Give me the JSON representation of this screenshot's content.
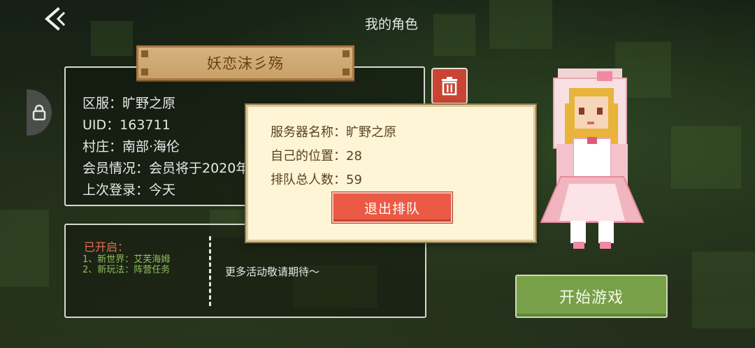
{
  "header": {
    "title": "我的角色",
    "back_icon": "chevron-left-icon"
  },
  "character": {
    "name": "妖恋沫彡殇",
    "info": [
      "区服：旷野之原",
      "UID：163711",
      "村庄：南部·海伦",
      "会员情况：会员将于2020年",
      "上次登录：今天"
    ]
  },
  "activities": {
    "title": "已开启：",
    "items": [
      "1、新世界：艾芙海姆",
      "2、新玩法：阵营任务"
    ],
    "more_text": "更多活动敬请期待～"
  },
  "queue_dialog": {
    "server_line": "服务器名称：旷野之原",
    "position_line": "自己的位置：28",
    "total_line": "排队总人数：59",
    "exit_button": "退出排队"
  },
  "start_button": "开始游戏",
  "colors": {
    "delete_red": "#c94434",
    "start_green": "#78a048",
    "exit_red": "#ea5a45",
    "dialog_bg": "#fdf5d6",
    "activity_title": "#e96b4d",
    "activity_item": "#8ec05a"
  }
}
